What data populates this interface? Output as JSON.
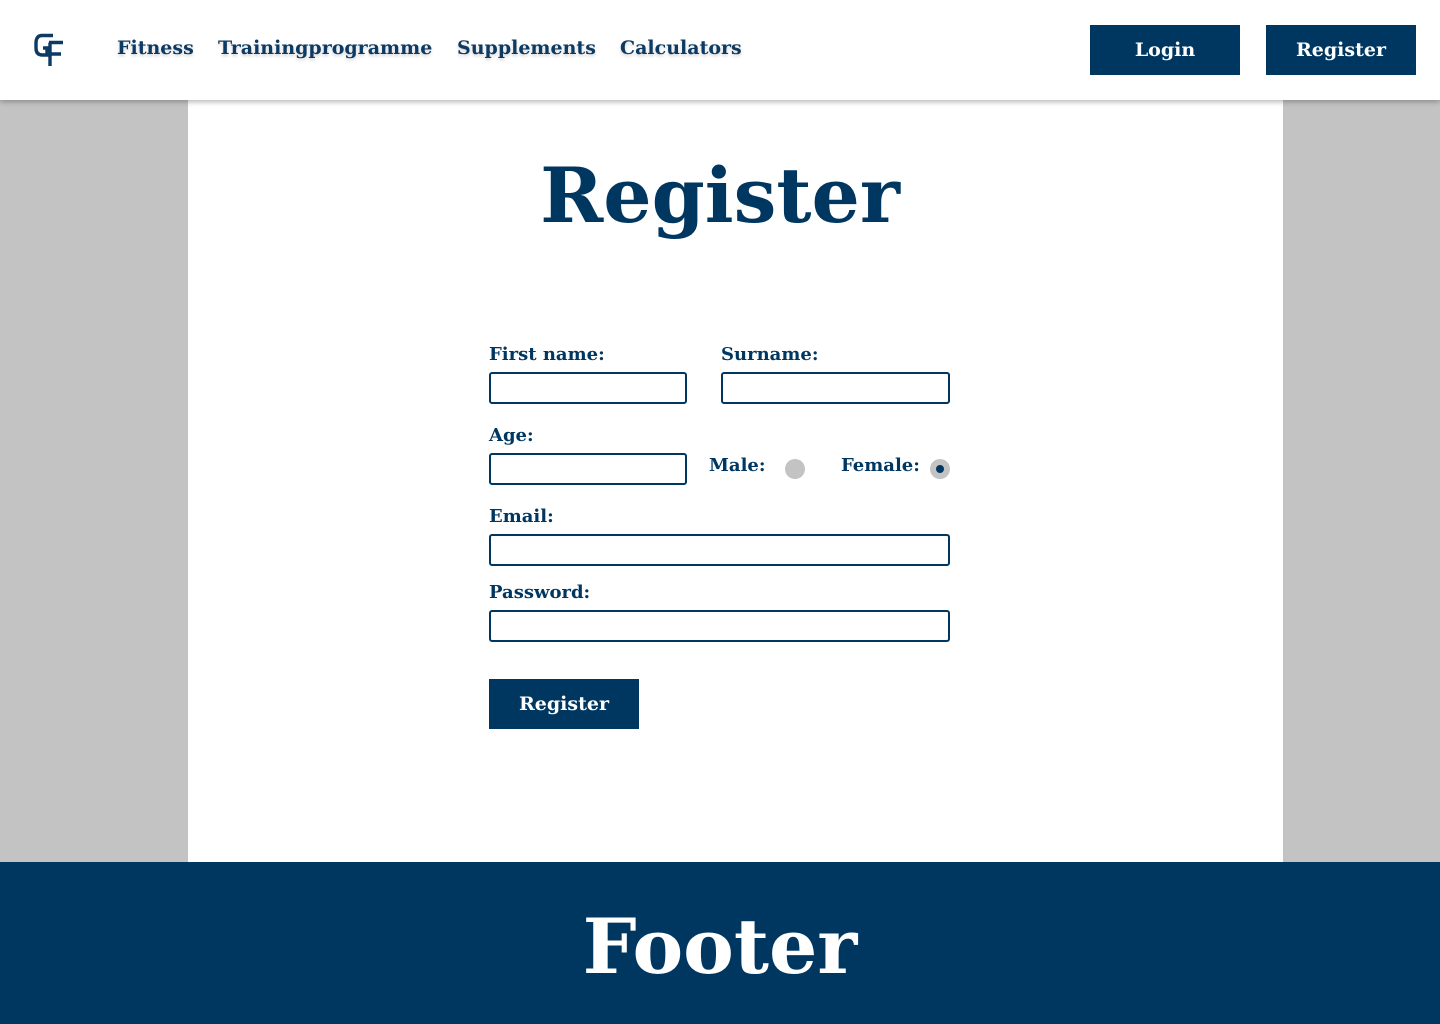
{
  "header": {
    "logo_text": "GF",
    "nav": {
      "fitness": "Fitness",
      "training": "Trainingprogramme",
      "supplements": "Supplements",
      "calculators": "Calculators"
    },
    "login_label": "Login",
    "register_label": "Register"
  },
  "main": {
    "title": "Register",
    "form": {
      "first_name_label": "First name:",
      "first_name_value": "",
      "surname_label": "Surname:",
      "surname_value": "",
      "age_label": "Age:",
      "age_value": "",
      "male_label": "Male:",
      "male_selected": false,
      "female_label": "Female:",
      "female_selected": true,
      "email_label": "Email:",
      "email_value": "",
      "password_label": "Password:",
      "password_value": "",
      "submit_label": "Register"
    }
  },
  "footer": {
    "title": "Footer"
  },
  "colors": {
    "brand": "#003761",
    "page_background": "#c3c3c3",
    "panel_background": "#ffffff"
  },
  "icons": {
    "logo": "gf-logo-icon"
  }
}
